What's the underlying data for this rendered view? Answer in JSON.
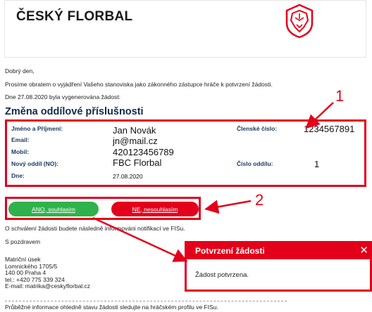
{
  "header": {
    "brand": "ČESKÝ FLORBAL",
    "logo_icon": "lion-shield-icon",
    "accent_color": "#e3001b"
  },
  "greeting": "Dobrý den,",
  "request_text": "Prosíme obratem o vyjádření Vašeho stanoviska jako zákonného zástupce hráče k potvrzení žádosti.",
  "generated_text": "Dne 27.08.2020 byla vygenerována žádost:",
  "title": "Změna oddílové příslušnosti",
  "details": {
    "name_label": "Jméno a Příjmení:",
    "name_value": "Jan Novák",
    "email_label": "Email:",
    "email_value": "jn@mail.cz",
    "mobile_label": "Mobil:",
    "mobile_value": "420123456789",
    "club_label": "Nový oddíl (NO):",
    "club_value": "FBC Florbal",
    "date_label": "Dne:",
    "date_value": "27.08.2020",
    "member_label": "Členské číslo:",
    "member_value": "1234567891",
    "club_no_label": "Číslo oddílu:",
    "club_no_value": "1"
  },
  "buttons": {
    "yes": "ANO, souhlasím",
    "no": "NE, nesouhlasím",
    "yes_color": "#2fb24c",
    "no_color": "#e3001b"
  },
  "notify_text": "O schválení žádosti budete následně informováni notifikací ve FISu.",
  "regards": "S pozdravem",
  "signature": {
    "line1": "Matriční úsek",
    "line2": "Lomnického 1705/5",
    "line3": "140 00 Praha 4",
    "line4": "tel.: +420 775 339 324",
    "line5": "E-mail: matrika@ceskyflorbal.cz"
  },
  "footer_text": "Průběžné informace ohledně stavu žádosti sledujte na hráčském profilu ve FISu.",
  "dialog": {
    "title": "Potvrzení žádosti",
    "message": "Žádost potvrzena.",
    "close_icon": "close-icon"
  },
  "annotations": {
    "one": "1",
    "two": "2"
  }
}
